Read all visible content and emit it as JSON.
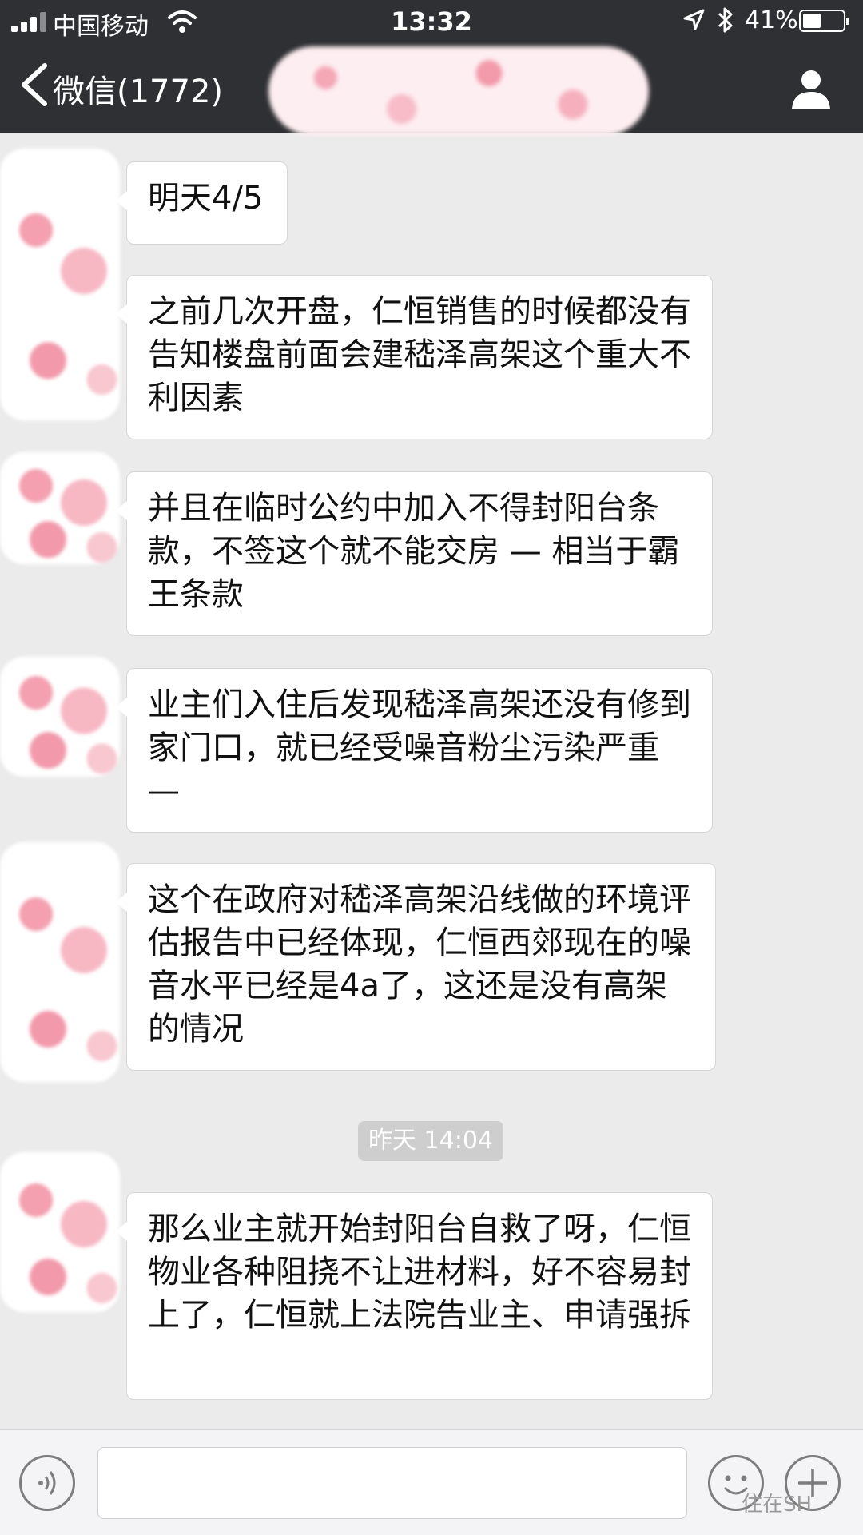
{
  "status_bar": {
    "carrier": "中国移动",
    "time": "13:32",
    "battery_percent": "41%",
    "battery_level": 0.41,
    "icons": [
      "signal-icon",
      "wifi-icon",
      "location-icon",
      "bluetooth-icon",
      "battery-icon"
    ]
  },
  "nav": {
    "back_label": "微信(1772)",
    "icons": [
      "chevron-left-icon",
      "person-icon"
    ]
  },
  "messages": [
    {
      "text": "明天4/5"
    },
    {
      "text": "之前几次开盘，仁恒销售的时候都没有告知楼盘前面会建嵇泽高架这个重大不利因素"
    },
    {
      "text": "并且在临时公约中加入不得封阳台条款，不签这个就不能交房 — 相当于霸王条款"
    },
    {
      "text": "业主们入住后发现嵇泽高架还没有修到家门口，就已经受噪音粉尘污染严重 —"
    },
    {
      "text": "这个在政府对嵇泽高架沿线做的环境评估报告中已经体现，仁恒西郊现在的噪音水平已经是4a了，这还是没有高架的情况"
    },
    {
      "text": "那么业主就开始封阳台自救了呀，仁恒物业各种阻挠不让进材料，好不容易封上了，仁恒就上法院告业主、申请强拆"
    }
  ],
  "timestamp": "昨天 14:04",
  "input_bar": {
    "icons": [
      "voice-icon",
      "emoji-icon",
      "plus-icon"
    ]
  },
  "watermark": "住在SH"
}
